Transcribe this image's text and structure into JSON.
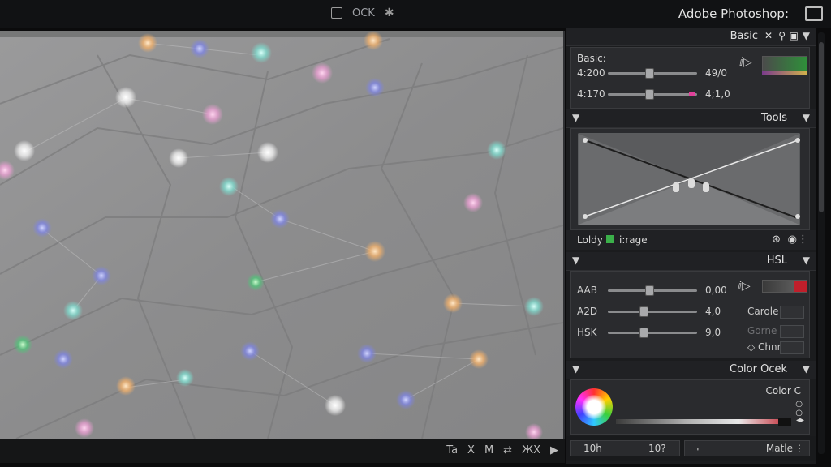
{
  "app": {
    "title": "Adobe Photoshop:",
    "top_center_label": "OCK",
    "icons": [
      "document-icon",
      "gear-icon",
      "window-icon"
    ]
  },
  "canvas": {
    "status_icons": [
      "Ta",
      "X",
      "M",
      "⇄",
      "ЖX",
      "▶"
    ]
  },
  "basic": {
    "header_label": "Basic",
    "header_icons": [
      "x-icon",
      "pin-icon",
      "camera-icon"
    ],
    "section_label": "Basic:",
    "rows": [
      {
        "name": "4:200",
        "value": "49/0",
        "level": 0.47
      },
      {
        "name": "4:170",
        "value": "4;1,0",
        "level": 0.47
      }
    ]
  },
  "tools": {
    "header_label": "Tools",
    "footer_label": "Loldy",
    "footer_tag": "i:rage"
  },
  "hsl": {
    "header_label": "HSL",
    "rows": [
      {
        "name": "AAB",
        "value": "0,00",
        "level": 0.47
      },
      {
        "name": "A2D",
        "value": "4,0",
        "level": 0.41
      },
      {
        "name": "HSK",
        "value": "9,0",
        "level": 0.41
      }
    ],
    "options": [
      "Carole",
      "Gorne",
      "Chnre"
    ]
  },
  "color": {
    "header_label": "Color Ocek",
    "label": "Color C"
  },
  "footer": {
    "left_a": "10h",
    "left_b": "10?",
    "right_label": "Matle"
  },
  "colors": {
    "accent_pink": "#e0409a",
    "accent_green": "#3bb04a",
    "swatch_red": "#c01f2b"
  }
}
